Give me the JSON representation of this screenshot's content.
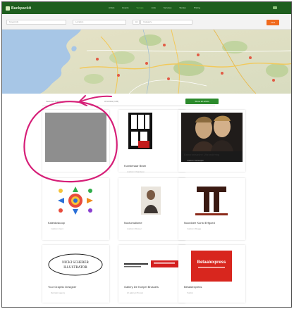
{
  "app": {
    "brand": "Backpackit"
  },
  "nav": {
    "items": [
      "Artists",
      "Events",
      "Venues",
      "Jobs",
      "Services",
      "Stories",
      "Pricing"
    ],
    "active_index": 2
  },
  "search": {
    "what_placeholder": "Keywords",
    "where_placeholder": "Location",
    "range_placeholder": "km",
    "category_placeholder": "Category",
    "button_label": "Find"
  },
  "tabs": {
    "first": "Featured Artists",
    "second": "All Artists (132)"
  },
  "show_button_label": "Show all artists",
  "cards": [
    {
      "title": "",
      "meta": "",
      "image": "gray-placeholder"
    },
    {
      "title": "Kunstenaar Bram",
      "meta": "2 artists in Vlaanderen",
      "image": "urban-logo"
    },
    {
      "title": "Baburanisashe Uitzondering",
      "meta": "3 artists in Antwerpen",
      "image": "portrait-duo"
    },
    {
      "title": "Kaleidoskoop",
      "meta": "4 artists in Gent",
      "image": "colorful-wheel"
    },
    {
      "title": "Nocturnalisme",
      "meta": "2 artists in Brussel",
      "image": "small-figure"
    },
    {
      "title": "Noordzee Kunst Erfgoed",
      "meta": "3 artists in Brugge",
      "image": "tt-logo"
    },
    {
      "title": "Your Graphic Designer",
      "meta": "Illustration agency",
      "image": "nicki-scherer-illustrator"
    },
    {
      "title": "Gallery De Koepel Brussels",
      "meta": "Art gallery in Brussel",
      "image": "red-banner"
    },
    {
      "title": "Betaalexpress",
      "meta": "5 artists",
      "image": "betaalexpress"
    }
  ],
  "card_texts": {
    "nicki_line1": "NICKI SCHERER",
    "nicki_line2": "ILLUSTRATOR",
    "betaal_line1": "Betaalexpress"
  },
  "colors": {
    "topbar": "#1e5e1e",
    "accent_orange": "#f06a1d",
    "green_button": "#2b8a2b",
    "annotation": "#d61f78"
  }
}
